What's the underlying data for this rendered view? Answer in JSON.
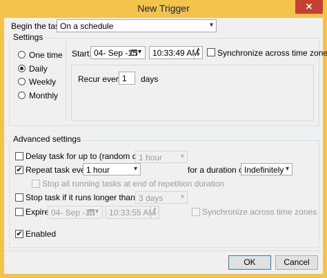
{
  "window": {
    "title": "New Trigger",
    "close_label": "✕"
  },
  "begin_task": {
    "label": "Begin the task:",
    "value": "On a schedule"
  },
  "settings": {
    "title": "Settings",
    "radios": [
      {
        "label": "One time",
        "selected": false
      },
      {
        "label": "Daily",
        "selected": true
      },
      {
        "label": "Weekly",
        "selected": false
      },
      {
        "label": "Monthly",
        "selected": false
      }
    ],
    "start_label": "Start:",
    "start_date": "04- Sep -15",
    "start_time": "10:33:49 AM",
    "sync_label": "Synchronize across time zones",
    "recur_label": "Recur every:",
    "recur_value": "1",
    "recur_unit": "days"
  },
  "advanced": {
    "title": "Advanced settings",
    "delay": {
      "label": "Delay task for up to (random delay):",
      "value": "1 hour",
      "checked": false
    },
    "repeat": {
      "label": "Repeat task every:",
      "value": "1 hour",
      "checked": true,
      "duration_label": "for a duration of:",
      "duration_value": "Indefinitely"
    },
    "stop_running": {
      "label": "Stop all running tasks at end of repetition duration",
      "checked": false
    },
    "stop_longer": {
      "label": "Stop task if it runs longer than:",
      "value": "3 days",
      "checked": false
    },
    "expire": {
      "label": "Expire:",
      "date": "04- Sep -16",
      "time": "10:33:55 AM",
      "sync_label": "Synchronize across time zones",
      "checked": false
    },
    "enabled": {
      "label": "Enabled",
      "checked": true
    }
  },
  "buttons": {
    "ok": "OK",
    "cancel": "Cancel"
  },
  "icons": {
    "check": "✔",
    "dropdown": "▾"
  }
}
